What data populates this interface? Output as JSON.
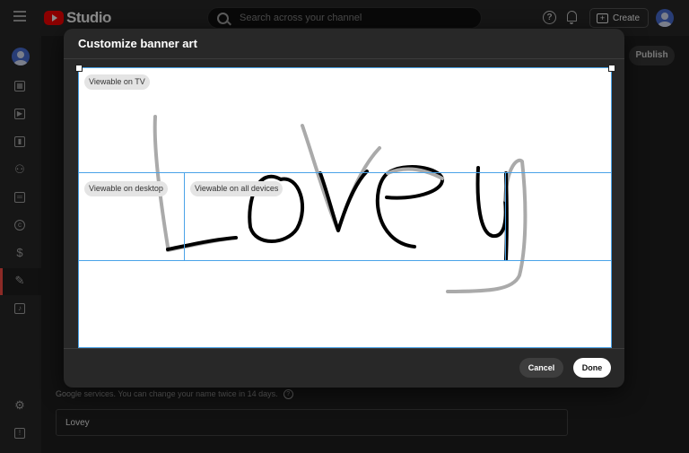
{
  "header": {
    "logo_text": "Studio",
    "search_placeholder": "Search across your channel",
    "create_label": "Create"
  },
  "sidebar": {
    "items": [
      {
        "icon": "dashboard-icon"
      },
      {
        "icon": "content-icon"
      },
      {
        "icon": "analytics-icon"
      },
      {
        "icon": "community-icon"
      },
      {
        "icon": "subtitles-icon"
      },
      {
        "icon": "copyright-icon"
      },
      {
        "icon": "earn-icon"
      },
      {
        "icon": "customization-icon",
        "active": true
      },
      {
        "icon": "audio-library-icon"
      }
    ],
    "bottom": [
      {
        "icon": "settings-icon"
      },
      {
        "icon": "feedback-icon"
      }
    ]
  },
  "page": {
    "publish_label": "Publish",
    "name_help_text": "Google services. You can change your name twice in 14 days.",
    "name_value": "Lovey"
  },
  "modal": {
    "title": "Customize banner art",
    "zones": {
      "tv": "Viewable on TV",
      "desktop": "Viewable on desktop",
      "all_devices": "Viewable on all devices"
    },
    "cancel_label": "Cancel",
    "done_label": "Done"
  },
  "colors": {
    "accent_red": "#ff0000",
    "guide_blue": "#4aa3e8"
  }
}
